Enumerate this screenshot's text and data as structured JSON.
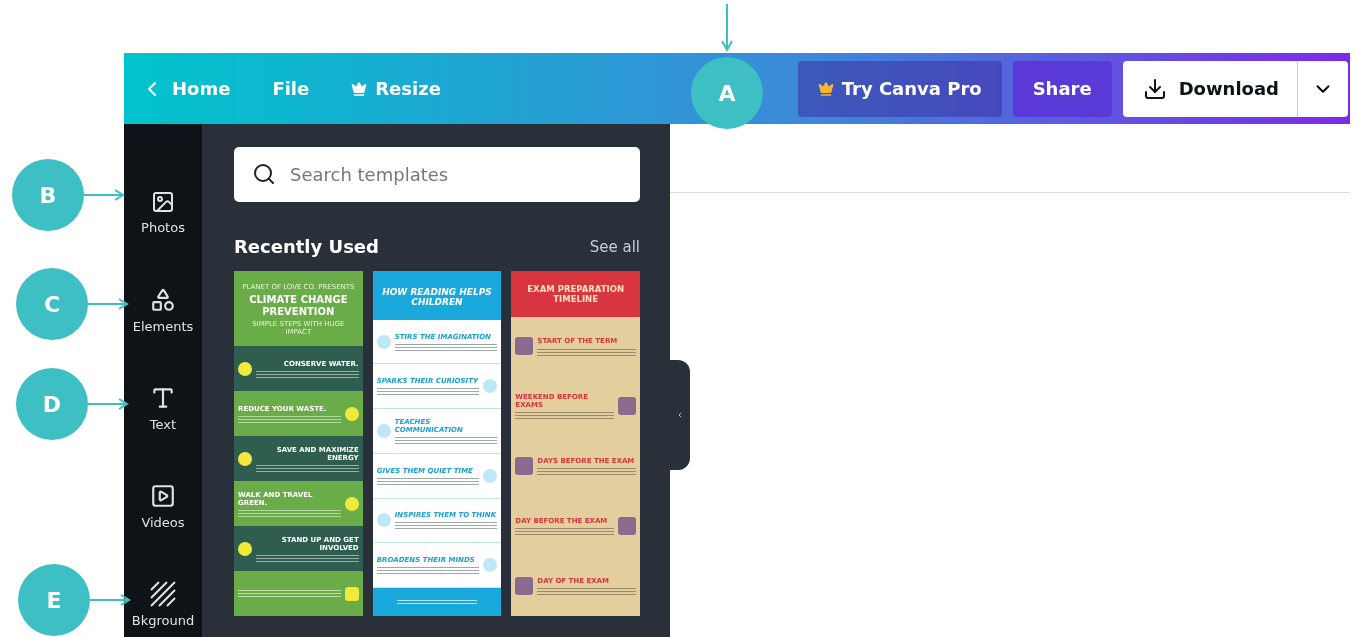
{
  "callouts": [
    {
      "label": "A",
      "kind": "down"
    },
    {
      "label": "B",
      "kind": "right"
    },
    {
      "label": "C",
      "kind": "right"
    },
    {
      "label": "D",
      "kind": "right"
    },
    {
      "label": "E",
      "kind": "right"
    }
  ],
  "top_bar": {
    "nav": [
      {
        "label": "Home",
        "kind": "back"
      },
      {
        "label": "File",
        "kind": "plain"
      },
      {
        "label": "Resize",
        "kind": "pro"
      }
    ],
    "buttons": [
      {
        "label": "Try Canva Pro",
        "kind": "pro"
      },
      {
        "label": "Share",
        "kind": "share"
      },
      {
        "label": "Download",
        "kind": "download"
      }
    ]
  },
  "sidebar": {
    "items": [
      {
        "label": "Photos",
        "kind": "photos"
      },
      {
        "label": "Elements",
        "kind": "elements"
      },
      {
        "label": "Text",
        "kind": "text"
      },
      {
        "label": "Videos",
        "kind": "videos"
      },
      {
        "label": "Bkground",
        "kind": "background"
      }
    ]
  },
  "panel": {
    "search": {
      "placeholder": "Search templates"
    },
    "section_title": "Recently Used",
    "see_all": "See all",
    "templates": [
      {
        "kind": "climate",
        "pre_title": "PLANET OF LOVE CO. PRESENTS",
        "title": "CLIMATE CHANGE PREVENTION",
        "subtitle": "SIMPLE STEPS WITH HUGE IMPACT",
        "sections": [
          "CONSERVE WATER.",
          "REDUCE YOUR WASTE.",
          "SAVE AND MAXIMIZE ENERGY",
          "WALK AND TRAVEL GREEN.",
          "STAND UP AND GET INVOLVED"
        ]
      },
      {
        "kind": "reading",
        "title": "HOW READING HELPS CHILDREN",
        "sections": [
          "STIRS THE IMAGINATION",
          "SPARKS THEIR CURIOSITY",
          "TEACHES COMMUNICATION",
          "GIVES THEM QUIET TIME",
          "INSPIRES THEM TO THINK",
          "BROADENS THEIR MINDS"
        ]
      },
      {
        "kind": "exam",
        "title": "EXAM PREPARATION TIMELINE",
        "sections": [
          "START OF THE TERM",
          "WEEKEND BEFORE EXAMS",
          "DAYS BEFORE THE EXAM",
          "DAY BEFORE THE EXAM",
          "DAY OF THE EXAM"
        ]
      }
    ]
  }
}
